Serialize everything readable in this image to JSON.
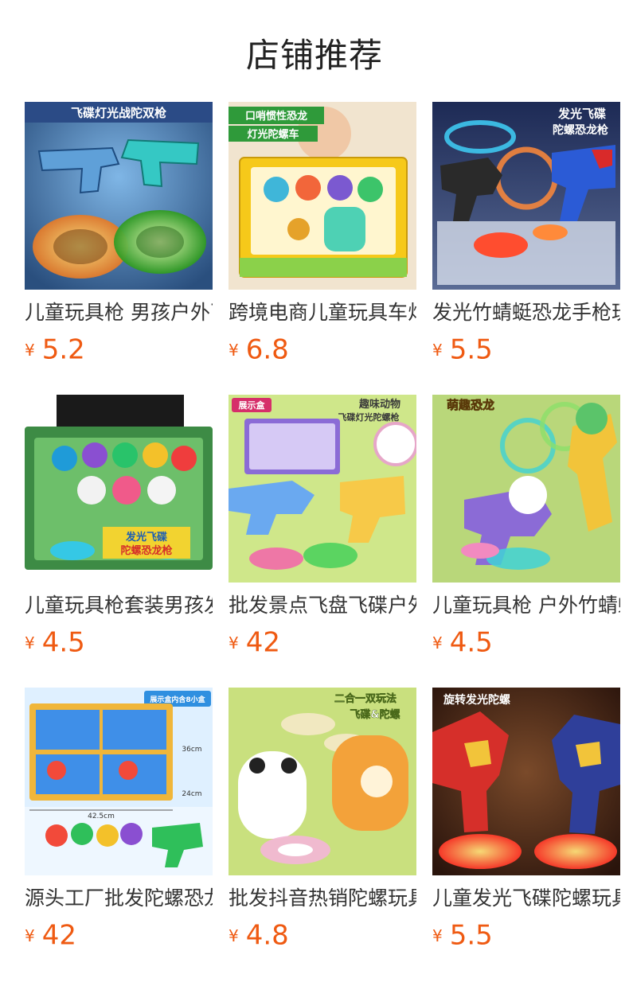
{
  "page": {
    "title": "店铺推荐"
  },
  "currency": "¥",
  "products": [
    {
      "name": "儿童玩具枪 男孩户外飞碟陀螺",
      "price": "5.2",
      "image": {
        "icon": "toy-gun-spinning-top-photo",
        "text": [
          "飞碟灯光战陀双枪"
        ],
        "colors": {
          "bg": "#4a7fae",
          "accent": "#35c8c4",
          "tops": [
            "#e27a2a",
            "#76d23a"
          ]
        }
      }
    },
    {
      "name": "跨境电商儿童玩具车灯光陀螺",
      "price": "6.8",
      "image": {
        "icon": "boxed-toy-set-photo",
        "text": [
          "口哨惯性恐龙",
          "灯光陀螺车"
        ],
        "colors": {
          "bg": "#f3e2c7",
          "accent": "#f6c91a",
          "tops": [
            "#3fb6d9",
            "#f2663a"
          ]
        }
      }
    },
    {
      "name": "发光竹蜻蜓恐龙手枪玩具",
      "price": "5.5",
      "image": {
        "icon": "dinosaur-gun-photo",
        "text": [
          "发光飞碟",
          "陀螺恐龙枪"
        ],
        "colors": {
          "bg": "#263a6a",
          "accent": "#ff6a3a",
          "tops": [
            "#3ec8f0",
            "#ff4d2f"
          ]
        }
      }
    },
    {
      "name": "儿童玩具枪套装男孩发光",
      "price": "4.5",
      "image": {
        "icon": "gift-box-set-photo",
        "text": [
          "发光飞碟",
          "陀螺恐龙枪"
        ],
        "colors": {
          "bg": "#3d8b45",
          "accent": "#f2d330",
          "tops": [
            "#8a4fd1",
            "#35c8e5"
          ]
        }
      }
    },
    {
      "name": "批发景点飞盘飞碟户外玩具",
      "price": "42",
      "image": {
        "icon": "animal-gun-display-photo",
        "text": [
          "趣味动物",
          "飞碟灯光陀螺枪",
          "展示盒"
        ],
        "colors": {
          "bg": "#cfe78a",
          "accent": "#6aa9f0",
          "tops": [
            "#f16aa8",
            "#4ed15c"
          ]
        }
      }
    },
    {
      "name": "儿童玩具枪 户外竹蜻蜓发光",
      "price": "4.5",
      "image": {
        "icon": "cute-dinosaur-gun-photo",
        "text": [
          "萌趣恐龙"
        ],
        "colors": {
          "bg": "#b9d77a",
          "accent": "#8b6bd6",
          "tops": [
            "#3fd2d6",
            "#f28ac0"
          ]
        }
      }
    },
    {
      "name": "源头工厂批发陀螺恐龙枪展示盒",
      "price": "42",
      "image": {
        "icon": "display-box-photo",
        "text": [
          "展示盒内含8小盒",
          "42.5cm",
          "24cm",
          "36cm"
        ],
        "colors": {
          "bg": "#dff0ff",
          "accent": "#2f8fe0",
          "tops": [
            "#f24a3a",
            "#2fbf5a"
          ]
        }
      }
    },
    {
      "name": "批发抖音热销陀螺玩具飞碟",
      "price": "4.8",
      "image": {
        "icon": "panda-tiger-launcher-photo",
        "text": [
          "二合一双玩法",
          "飞碟&陀螺"
        ],
        "colors": {
          "bg": "#c9e07e",
          "accent": "#f3a23a",
          "tops": [
            "#f5e9c8",
            "#f4b6d8"
          ]
        }
      }
    },
    {
      "name": "儿童发光飞碟陀螺玩具枪",
      "price": "5.5",
      "image": {
        "icon": "dragon-launcher-photo",
        "text": [
          "旋转发光陀螺"
        ],
        "colors": {
          "bg": "#3a2218",
          "accent": "#d62f2a",
          "tops": [
            "#ff9a2a",
            "#ff3a2a"
          ]
        }
      }
    }
  ]
}
